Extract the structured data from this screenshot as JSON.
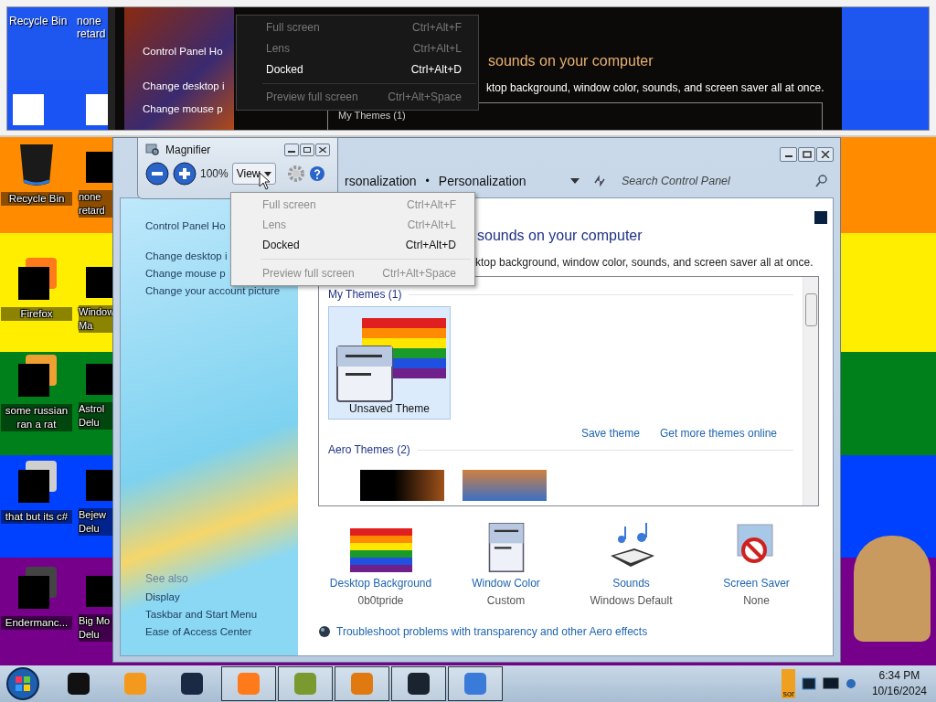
{
  "magnifier_view": {
    "desktop_labels": [
      "Recycle Bin",
      "none",
      "retard"
    ],
    "menu_items": [
      {
        "label": "Full screen",
        "shortcut": "Ctrl+Alt+F",
        "disabled": true
      },
      {
        "label": "Lens",
        "shortcut": "Ctrl+Alt+L",
        "disabled": true
      },
      {
        "label": "Docked",
        "shortcut": "Ctrl+Alt+D",
        "disabled": false
      },
      {
        "label": "Preview full screen",
        "shortcut": "Ctrl+Alt+Space",
        "disabled": true,
        "separator_before": true
      }
    ],
    "sidebar_links": [
      "Control Panel Ho",
      "Change desktop i",
      "Change mouse p"
    ],
    "heading": "sounds on your computer",
    "description": "ktop background, window color, sounds, and screen saver all at once.",
    "group_label": "My Themes (1)"
  },
  "desktop": {
    "column_1": [
      {
        "label": "Recycle Bin",
        "kind": "bin"
      },
      {
        "label": "Firefox",
        "kind": "firefox"
      },
      {
        "label": "some russian ran a rat",
        "kind": "app"
      },
      {
        "label": "that but its c#",
        "kind": "stack"
      },
      {
        "label": "Endermanc...",
        "kind": "console"
      }
    ],
    "column_2": [
      {
        "lines": [
          "none",
          "retard"
        ]
      },
      {
        "lines": [
          "Window",
          "Ma"
        ]
      },
      {
        "lines": [
          "Astrol",
          "Delu"
        ]
      },
      {
        "lines": [
          "Bejew",
          "Delu"
        ]
      },
      {
        "lines": [
          "Big Mo",
          "Delu"
        ]
      }
    ]
  },
  "personalization": {
    "breadcrumb": [
      "rsonalization",
      "Personalization"
    ],
    "breadcrumb_separator": "•",
    "search": {
      "placeholder": "Search Control Panel"
    },
    "left_links": [
      "Control Panel Ho",
      "Change desktop i",
      "Change mouse p",
      "Change your account picture"
    ],
    "see_also": {
      "title": "See also",
      "links": [
        "Display",
        "Taskbar and Start Menu",
        "Ease of Access Center"
      ]
    },
    "heading": "sounds on your computer",
    "description": "ktop background, window color, sounds, and screen saver all at once.",
    "my_themes": {
      "title": "My Themes (1)",
      "themes": [
        {
          "name": "Unsaved Theme",
          "selected": true
        }
      ]
    },
    "theme_actions": [
      "Save theme",
      "Get more themes online"
    ],
    "aero_themes": {
      "title": "Aero Themes (2)",
      "themes": [
        {
          "kind": "dark",
          "selected": false
        },
        {
          "kind": "stack",
          "selected": false
        }
      ]
    },
    "settings": [
      {
        "label": "Desktop Background",
        "value": "0b0tpride",
        "kind": "wallpaper"
      },
      {
        "label": "Window Color",
        "value": "Custom",
        "kind": "window"
      },
      {
        "label": "Sounds",
        "value": "Windows Default",
        "kind": "sounds"
      },
      {
        "label": "Screen Saver",
        "value": "None",
        "kind": "screensaver"
      }
    ],
    "troubleshoot_link": "Troubleshoot problems with transparency and other Aero effects"
  },
  "magnifier": {
    "title": "Magnifier",
    "zoom": "100%",
    "view_button": "View",
    "menu_items": [
      {
        "label": "Full screen",
        "shortcut": "Ctrl+Alt+F",
        "disabled": true
      },
      {
        "label": "Lens",
        "shortcut": "Ctrl+Alt+L",
        "disabled": true
      },
      {
        "label": "Docked",
        "shortcut": "Ctrl+Alt+D",
        "disabled": false
      },
      {
        "label": "Preview full screen",
        "shortcut": "Ctrl+Alt+Space",
        "disabled": true,
        "separator_before": true
      }
    ]
  },
  "taskbar": {
    "items": [
      {
        "kind": "box",
        "running": false
      },
      {
        "kind": "media",
        "running": false
      },
      {
        "kind": "globe",
        "running": false
      },
      {
        "kind": "firefox",
        "running": true
      },
      {
        "kind": "game",
        "running": true
      },
      {
        "kind": "figure",
        "running": true
      },
      {
        "kind": "screen",
        "running": true
      },
      {
        "kind": "magnifier",
        "running": true
      }
    ],
    "tray_label": "sor",
    "time": "6:34 PM",
    "date": "10/16/2024"
  }
}
